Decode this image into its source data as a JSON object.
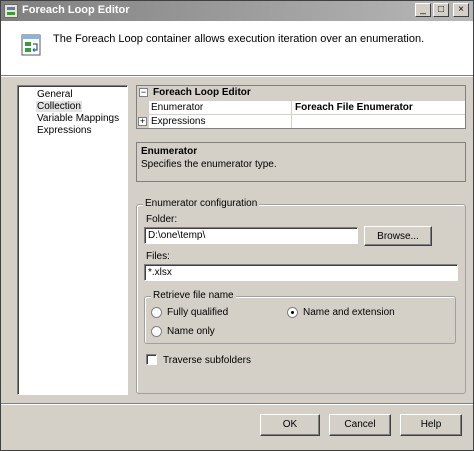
{
  "window": {
    "title": "Foreach Loop Editor",
    "controls": {
      "minimize": "_",
      "maximize": "□",
      "close": "×"
    }
  },
  "header": {
    "description": "The Foreach Loop container allows execution iteration over an enumeration."
  },
  "nav": {
    "items": [
      {
        "label": "General",
        "selected": false
      },
      {
        "label": "Collection",
        "selected": true
      },
      {
        "label": "Variable Mappings",
        "selected": false
      },
      {
        "label": "Expressions",
        "selected": false
      }
    ]
  },
  "property_grid": {
    "category": "Foreach Loop Editor",
    "expander_collapse": "−",
    "expander_expand": "+",
    "rows": [
      {
        "name": "Enumerator",
        "value": "Foreach File Enumerator"
      },
      {
        "name": "Expressions",
        "value": ""
      }
    ]
  },
  "description_panel": {
    "title": "Enumerator",
    "text": "Specifies the enumerator type."
  },
  "config": {
    "group_label": "Enumerator configuration",
    "folder_label": "Folder:",
    "folder_value": "D:\\one\\temp\\",
    "browse_label": "Browse...",
    "files_label": "Files:",
    "files_value": "*.xlsx",
    "retrieve_group_label": "Retrieve file name",
    "options": {
      "fully_qualified": "Fully qualified",
      "name_and_extension": "Name and extension",
      "name_only": "Name only"
    },
    "selected_option": "name_and_extension",
    "traverse_label": "Traverse subfolders",
    "traverse_checked": false
  },
  "footer": {
    "ok": "OK",
    "cancel": "Cancel",
    "help": "Help"
  }
}
